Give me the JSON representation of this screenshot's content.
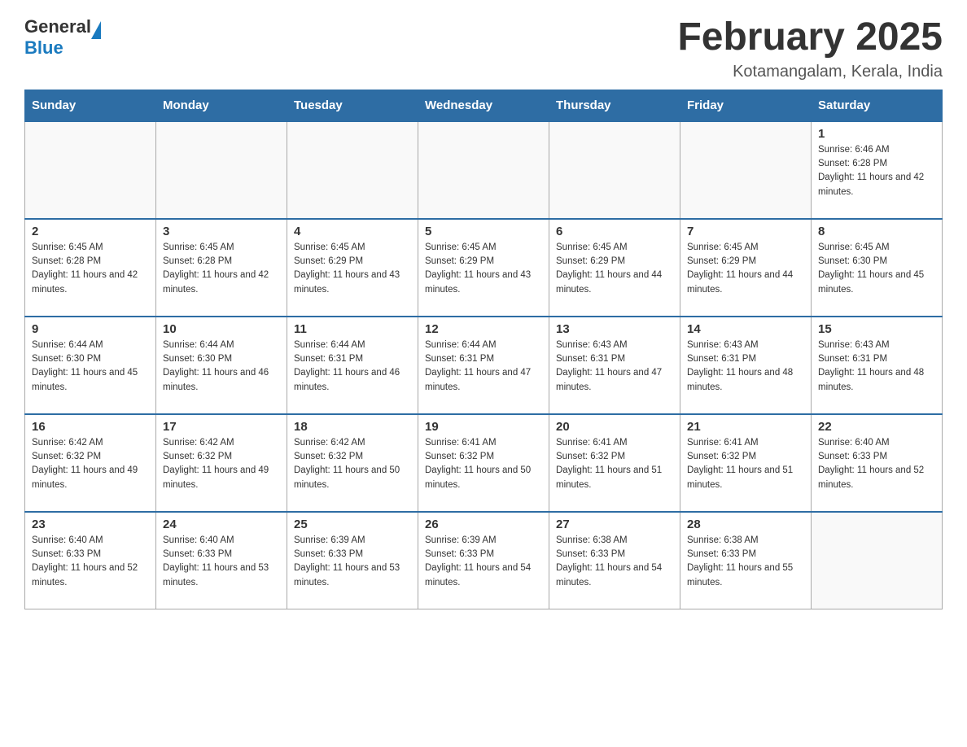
{
  "header": {
    "logo": {
      "general": "General",
      "blue": "Blue"
    },
    "title": "February 2025",
    "location": "Kotamangalam, Kerala, India"
  },
  "weekdays": [
    "Sunday",
    "Monday",
    "Tuesday",
    "Wednesday",
    "Thursday",
    "Friday",
    "Saturday"
  ],
  "weeks": [
    [
      {
        "day": "",
        "info": ""
      },
      {
        "day": "",
        "info": ""
      },
      {
        "day": "",
        "info": ""
      },
      {
        "day": "",
        "info": ""
      },
      {
        "day": "",
        "info": ""
      },
      {
        "day": "",
        "info": ""
      },
      {
        "day": "1",
        "info": "Sunrise: 6:46 AM\nSunset: 6:28 PM\nDaylight: 11 hours and 42 minutes."
      }
    ],
    [
      {
        "day": "2",
        "info": "Sunrise: 6:45 AM\nSunset: 6:28 PM\nDaylight: 11 hours and 42 minutes."
      },
      {
        "day": "3",
        "info": "Sunrise: 6:45 AM\nSunset: 6:28 PM\nDaylight: 11 hours and 42 minutes."
      },
      {
        "day": "4",
        "info": "Sunrise: 6:45 AM\nSunset: 6:29 PM\nDaylight: 11 hours and 43 minutes."
      },
      {
        "day": "5",
        "info": "Sunrise: 6:45 AM\nSunset: 6:29 PM\nDaylight: 11 hours and 43 minutes."
      },
      {
        "day": "6",
        "info": "Sunrise: 6:45 AM\nSunset: 6:29 PM\nDaylight: 11 hours and 44 minutes."
      },
      {
        "day": "7",
        "info": "Sunrise: 6:45 AM\nSunset: 6:29 PM\nDaylight: 11 hours and 44 minutes."
      },
      {
        "day": "8",
        "info": "Sunrise: 6:45 AM\nSunset: 6:30 PM\nDaylight: 11 hours and 45 minutes."
      }
    ],
    [
      {
        "day": "9",
        "info": "Sunrise: 6:44 AM\nSunset: 6:30 PM\nDaylight: 11 hours and 45 minutes."
      },
      {
        "day": "10",
        "info": "Sunrise: 6:44 AM\nSunset: 6:30 PM\nDaylight: 11 hours and 46 minutes."
      },
      {
        "day": "11",
        "info": "Sunrise: 6:44 AM\nSunset: 6:31 PM\nDaylight: 11 hours and 46 minutes."
      },
      {
        "day": "12",
        "info": "Sunrise: 6:44 AM\nSunset: 6:31 PM\nDaylight: 11 hours and 47 minutes."
      },
      {
        "day": "13",
        "info": "Sunrise: 6:43 AM\nSunset: 6:31 PM\nDaylight: 11 hours and 47 minutes."
      },
      {
        "day": "14",
        "info": "Sunrise: 6:43 AM\nSunset: 6:31 PM\nDaylight: 11 hours and 48 minutes."
      },
      {
        "day": "15",
        "info": "Sunrise: 6:43 AM\nSunset: 6:31 PM\nDaylight: 11 hours and 48 minutes."
      }
    ],
    [
      {
        "day": "16",
        "info": "Sunrise: 6:42 AM\nSunset: 6:32 PM\nDaylight: 11 hours and 49 minutes."
      },
      {
        "day": "17",
        "info": "Sunrise: 6:42 AM\nSunset: 6:32 PM\nDaylight: 11 hours and 49 minutes."
      },
      {
        "day": "18",
        "info": "Sunrise: 6:42 AM\nSunset: 6:32 PM\nDaylight: 11 hours and 50 minutes."
      },
      {
        "day": "19",
        "info": "Sunrise: 6:41 AM\nSunset: 6:32 PM\nDaylight: 11 hours and 50 minutes."
      },
      {
        "day": "20",
        "info": "Sunrise: 6:41 AM\nSunset: 6:32 PM\nDaylight: 11 hours and 51 minutes."
      },
      {
        "day": "21",
        "info": "Sunrise: 6:41 AM\nSunset: 6:32 PM\nDaylight: 11 hours and 51 minutes."
      },
      {
        "day": "22",
        "info": "Sunrise: 6:40 AM\nSunset: 6:33 PM\nDaylight: 11 hours and 52 minutes."
      }
    ],
    [
      {
        "day": "23",
        "info": "Sunrise: 6:40 AM\nSunset: 6:33 PM\nDaylight: 11 hours and 52 minutes."
      },
      {
        "day": "24",
        "info": "Sunrise: 6:40 AM\nSunset: 6:33 PM\nDaylight: 11 hours and 53 minutes."
      },
      {
        "day": "25",
        "info": "Sunrise: 6:39 AM\nSunset: 6:33 PM\nDaylight: 11 hours and 53 minutes."
      },
      {
        "day": "26",
        "info": "Sunrise: 6:39 AM\nSunset: 6:33 PM\nDaylight: 11 hours and 54 minutes."
      },
      {
        "day": "27",
        "info": "Sunrise: 6:38 AM\nSunset: 6:33 PM\nDaylight: 11 hours and 54 minutes."
      },
      {
        "day": "28",
        "info": "Sunrise: 6:38 AM\nSunset: 6:33 PM\nDaylight: 11 hours and 55 minutes."
      },
      {
        "day": "",
        "info": ""
      }
    ]
  ]
}
